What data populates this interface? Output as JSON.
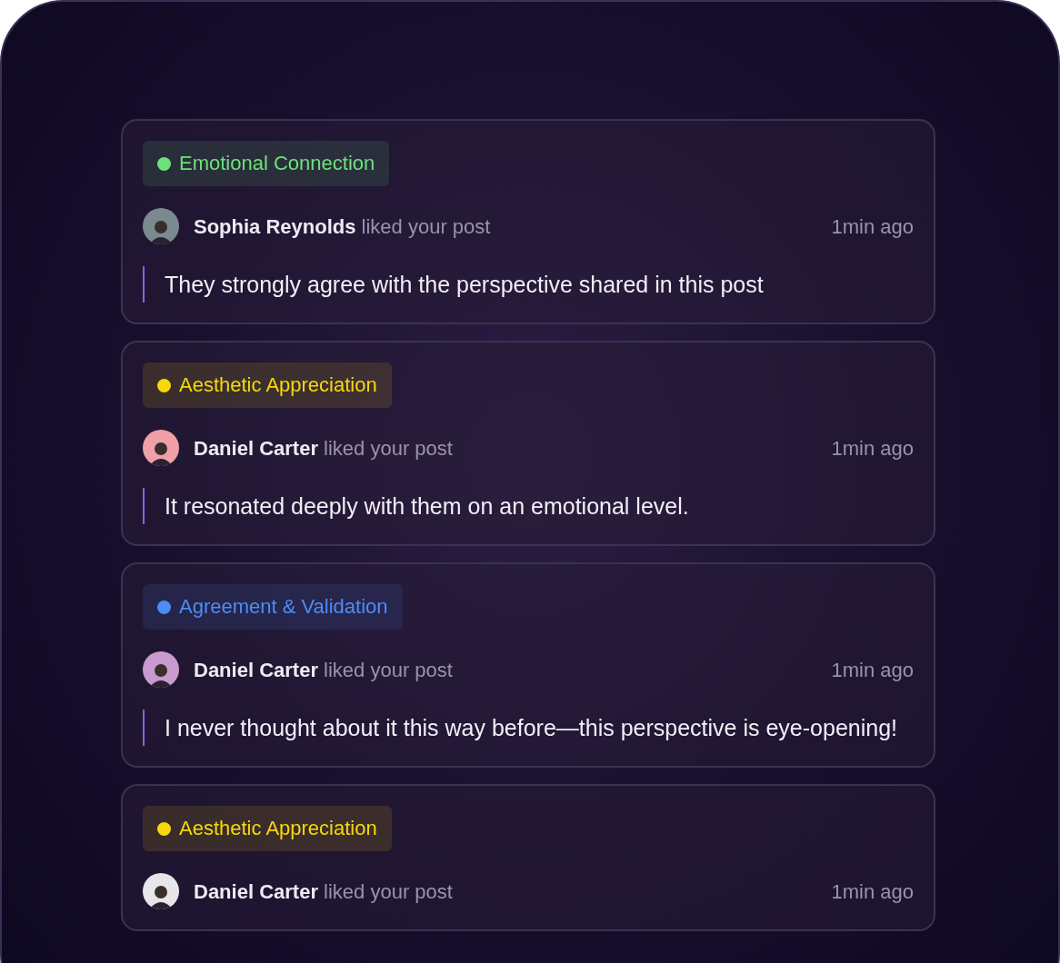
{
  "notifications": [
    {
      "tag": {
        "label": "Emotional Connection",
        "color": "#6ee07a"
      },
      "user": "Sophia Reynolds",
      "action": "liked your post",
      "time": "1min ago",
      "message": "They strongly agree with the perspective shared in this post"
    },
    {
      "tag": {
        "label": "Aesthetic Appreciation",
        "color": "#f5d90a"
      },
      "user": "Daniel Carter",
      "action": "liked your post",
      "time": "1min ago",
      "message": "It resonated deeply with them on an emotional level."
    },
    {
      "tag": {
        "label": "Agreement & Validation",
        "color": "#4d8cf5"
      },
      "user": "Daniel Carter",
      "action": "liked your post",
      "time": "1min ago",
      "message": "I never thought about it this way before—this perspective is eye-opening!"
    },
    {
      "tag": {
        "label": "Aesthetic Appreciation",
        "color": "#f5d90a"
      },
      "user": "Daniel Carter",
      "action": "liked your post",
      "time": "1min ago"
    }
  ]
}
